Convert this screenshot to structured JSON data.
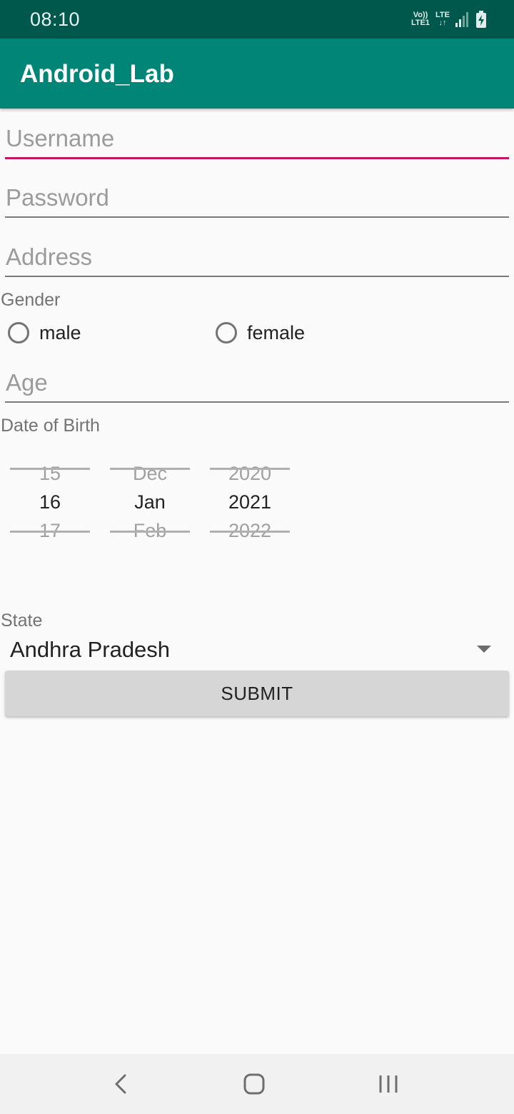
{
  "status_bar": {
    "time": "08:10",
    "volte_top": "Vo))",
    "volte_bottom": "LTE1",
    "lte_top": "LTE",
    "lte_bottom": "↓↑"
  },
  "app_bar": {
    "title": "Android_Lab"
  },
  "form": {
    "username_placeholder": "Username",
    "password_placeholder": "Password",
    "address_placeholder": "Address",
    "gender_label": "Gender",
    "gender_options": [
      "male",
      "female"
    ],
    "age_placeholder": "Age",
    "dob_label": "Date of Birth",
    "date_picker": {
      "day": {
        "prev": "15",
        "selected": "16",
        "next": "17"
      },
      "month": {
        "prev": "Dec",
        "selected": "Jan",
        "next": "Feb"
      },
      "year": {
        "prev": "2020",
        "selected": "2021",
        "next": "2022"
      }
    },
    "state_label": "State",
    "state_selected": "Andhra Pradesh",
    "submit_label": "SUBMIT"
  },
  "colors": {
    "status_bar": "#00574b",
    "app_bar": "#008577",
    "accent": "#c2185b"
  }
}
